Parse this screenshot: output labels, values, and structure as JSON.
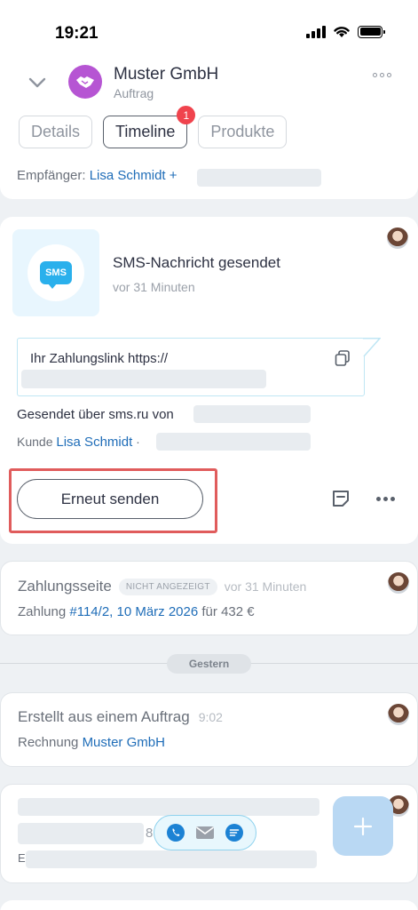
{
  "status_bar": {
    "time": "19:21"
  },
  "header": {
    "title": "Muster GmbH",
    "subtitle": "Auftrag"
  },
  "tabs": [
    {
      "label": "Details"
    },
    {
      "label": "Timeline",
      "badge": "1",
      "active": true
    },
    {
      "label": "Produkte"
    }
  ],
  "recipient_card": {
    "label": "Empfänger:",
    "name": "Lisa Schmidt",
    "more": "+"
  },
  "sms_card": {
    "icon_label": "SMS",
    "title": "SMS-Nachricht gesendet",
    "time": "vor 31 Minuten",
    "message": "Ihr Zahlungslink  https://",
    "sent_via": "Gesendet über sms.ru von",
    "customer_label": "Kunde",
    "customer_name": "Lisa Schmidt",
    "customer_sep": "·",
    "resend_label": "Erneut senden"
  },
  "payment_card": {
    "title": "Zahlungsseite",
    "pill": "NICHT ANGEZEIGT",
    "time": "vor 31 Minuten",
    "prefix": "Zahlung",
    "link": "#114/2, 10 März 2026",
    "suffix": "für 432 €"
  },
  "date_divider": "Gestern",
  "invoice_card": {
    "title": "Erstellt aus einem Auftrag",
    "time": "9:02",
    "prefix": "Rechnung",
    "link": "Muster GmbH"
  },
  "partial_card": {
    "digit": "8",
    "letter": "E"
  },
  "colors": {
    "accent": "#1f6db8",
    "sms_blue": "#2ab0ec",
    "logo_purple": "#b655d3",
    "badge_red": "#f0434d",
    "highlight": "#e05c5c"
  }
}
